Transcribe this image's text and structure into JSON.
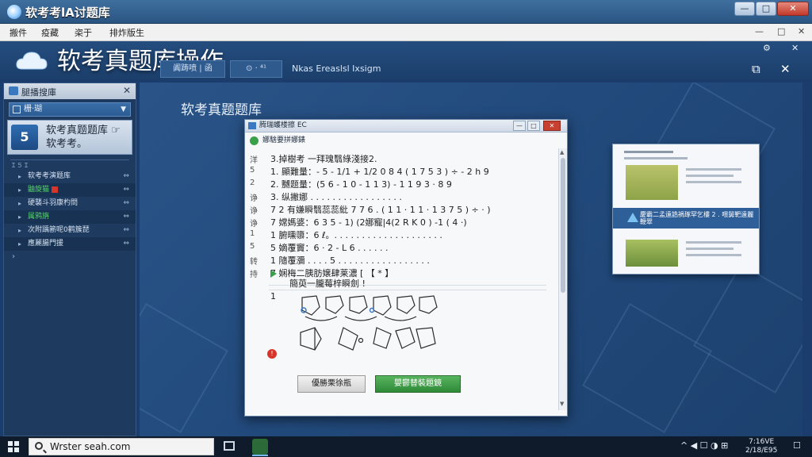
{
  "window": {
    "title": "软考考lA讨题库",
    "controls": {
      "minimize": "—",
      "maximize": "□",
      "close": "✕"
    }
  },
  "menubar": {
    "items": [
      "搬件",
      "疫藏",
      "栥于",
      "排炸版生"
    ],
    "controls": {
      "minimize": "—",
      "restore": "□",
      "close": "✕"
    }
  },
  "header": {
    "title": "软考真题库操作",
    "button1": "阗踌喷 | 函",
    "button2": "⊙ · ⁴¹",
    "status_text": "Nkas Ereaslsl Ixsigm",
    "small_controls": {
      "settings": "⚙",
      "close": "✕"
    },
    "right_controls": {
      "dock": "⧉",
      "close": "✕"
    }
  },
  "sidebar": {
    "header": "腿播搜庫",
    "dropdown": "栅·瑚",
    "featured": "软考真题题库 ☞ 软考考。",
    "tiny_label": "Ｉ５Ｉ",
    "items": [
      {
        "label": "软考考演题库",
        "green": false
      },
      {
        "label": "鼬旋猫",
        "green": true
      },
      {
        "label": "硬襲斗羽康杓問",
        "green": false
      },
      {
        "label": "属鸦旃",
        "green": true
      },
      {
        "label": "次附踽簖呢0鹳簇琵",
        "green": false
      },
      {
        "label": "應麗腸門援",
        "green": false
      }
    ]
  },
  "main": {
    "title": "软考真题题库"
  },
  "dialog": {
    "title": "腾瑞蠖楼擦 EC",
    "header": "娜騇要拼娜錶",
    "side_labels": [
      "洋",
      "5",
      "2",
      "诤",
      "诤",
      "诤",
      "1",
      "5",
      "转",
      "持"
    ],
    "questions": {
      "q_head": "3.掉樹考 一拜瑰翳綠淺接2.",
      "q1": "1.    顯難量：- 5 - 1/1 + 1/2 0 8 4 ( 1 7 5 3 )  ÷ - 2 h 9",
      "q2": "2.    嬲题量：(5 6 - 1 0 - 1 1 3)  - 1 1 9 3  · 8 9",
      "q3": "3.    纵撇娜 . . . . . . . . . . . . . . . . .",
      "q7a": "7 2 有嫌瞬翳蕊蕊紕 7 7 6 . ( 1 1 ·  1 1 · 1 3 7 5 )  ÷ ·  )",
      "q7b": "7    嫦媽婆：6 3  5 - 1)  (2娜寵|4(2 R K 0 ) -1 ( 4 ·)",
      "q1b": "1    腑曛隳：6 ℓ。. . . . . . . . . . . . . . . . . . . .",
      "q5": "5    嫡覆竇：6 · 2 - L 6 . . . . . .",
      "q1c": "1    隨覆瀰  . . . .  5 . . . . . . . . . . . . . . . . .",
      "q7c": "7    娴梅二胰肪嬢肆莱濃 [ 【 * 】",
      "play_line": "簡萸一朧莓梓瞬劍 !",
      "num_after": "1"
    },
    "btn_cancel": "優勝栗徐瓶",
    "btn_confirm": "嬰鬱替裝題鏡"
  },
  "preview": {
    "band_text": "慶霸二孟遠誥禍琢罕乞樓 2 . 喂舅靶遠麗鞭翠"
  },
  "taskbar": {
    "search_text": "Wrster seah.com",
    "tray_icons": "^ ◀ ☐ ◑ ⊞",
    "time": "7:16VE",
    "date": "2/18/E95",
    "notification": "☐"
  },
  "colors": {
    "accent_green": "#3aa04a",
    "error_red": "#d8352a",
    "app_bg": "#1a3d6e"
  }
}
